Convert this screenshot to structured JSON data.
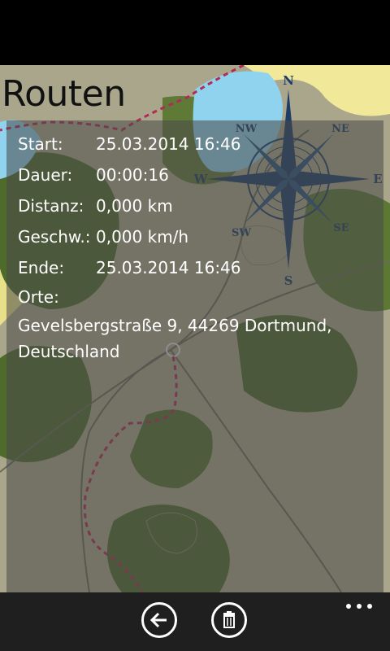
{
  "page": {
    "title": "Routen"
  },
  "route": {
    "start_label": "Start:",
    "start_value": "25.03.2014 16:46",
    "duration_label": "Dauer:",
    "duration_value": "00:00:16",
    "distance_label": "Distanz:",
    "distance_value": "0,000 km",
    "speed_label": "Geschw.:",
    "speed_value": "0,000 km/h",
    "end_label": "Ende:",
    "end_value": "25.03.2014 16:46",
    "places_label": "Orte:",
    "places_value": "Gevelsbergstraße 9, 44269 Dortmund, Deutschland"
  },
  "map": {
    "compass_labels": {
      "n": "N",
      "ne": "NE",
      "e": "E",
      "se": "SE",
      "s": "S",
      "sw": "SW",
      "w": "W",
      "nw": "NW"
    }
  },
  "app_bar": {
    "back_icon": "arrow-left-icon",
    "delete_icon": "trash-icon",
    "more_icon": "ellipsis-icon"
  },
  "colors": {
    "map_base": "#a9a68b",
    "forest": "#4e6b2c",
    "water": "#8fd3ee",
    "sand": "#f2e89a",
    "route": "#b22a55",
    "compass": "#1e3d66",
    "panel": "#484848"
  }
}
